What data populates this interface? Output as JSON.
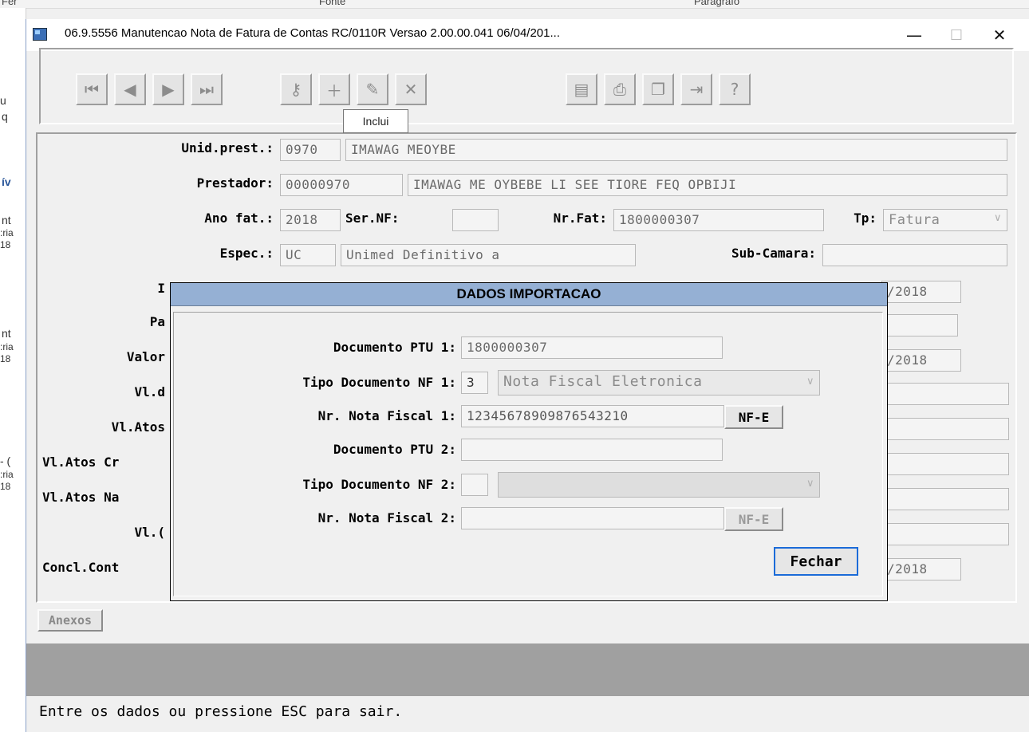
{
  "background": {
    "top_texts": [
      "Fer",
      "Fonte",
      "Parágrafo"
    ],
    "left_texts": [
      "u",
      "q",
      "ív",
      "nt",
      ":ria",
      "18",
      "nt",
      ":ria",
      "18",
      "- (",
      ":ria",
      "18"
    ]
  },
  "window": {
    "title": "06.9.5556 Manutencao  Nota de Fatura de Contas RC/0110R Versao 2.00.00.041 06/04/201...",
    "minimize": "—",
    "maximize": "☐",
    "close": "✕"
  },
  "toolbar": {
    "icons": [
      "first-record-icon",
      "prev-record-icon",
      "next-record-icon",
      "last-record-icon",
      "search-key-icon",
      "add-record-icon",
      "edit-record-icon",
      "delete-record-icon",
      "report-icon",
      "print-icon",
      "copy-icon",
      "exit-icon",
      "help-icon"
    ],
    "tooltip": "Inclui"
  },
  "form": {
    "unid_prest_label": "Unid.prest.:",
    "unid_prest_code": "0970",
    "unid_prest_name": "IMAWAG MEOYBE",
    "prestador_label": "Prestador:",
    "prestador_code": "00000970",
    "prestador_name": "IMAWAG ME OYBEBE LI SEE TIORE FEQ OPBIJI",
    "ano_fat_label": "Ano fat.:",
    "ano_fat": "2018",
    "ser_nf_label": "Ser.NF:",
    "ser_nf": "",
    "nr_fat_label": "Nr.Fat:",
    "nr_fat": "1800000307",
    "tp_label": "Tp:",
    "tp_value": "Fatura",
    "espec_label": "Espec.:",
    "espec_code": "UC",
    "espec_desc": "Unimed Definitivo a",
    "sub_camara_label": "Sub-Camara:",
    "sub_camara": "",
    "row5_label_partial": "I",
    "row6_label_partial": "Pa",
    "row7_label_partial": "Valor",
    "row8_label_partial": "Vl.d",
    "row9_label_partial": "Vl.Atos",
    "row10_label_partial": "Vl.Atos Cr",
    "row11_label_partial": "Vl.Atos Na",
    "row12_label_partial": "Vl.(",
    "row13_label_partial": "Concl.Cont",
    "date1_partial": "/2018",
    "date2_partial": "/2018",
    "date3_partial": "/2018",
    "anexos_label": "Anexos"
  },
  "dialog": {
    "title": "DADOS IMPORTACAO",
    "doc_ptu1_label": "Documento PTU 1:",
    "doc_ptu1": "1800000307",
    "tipo_doc1_label": "Tipo Documento NF 1:",
    "tipo_doc1_code": "3",
    "tipo_doc1_desc": "Nota Fiscal Eletronica",
    "nr_nf1_label": "Nr. Nota Fiscal 1:",
    "nr_nf1": "12345678909876543210",
    "nfe1_button": "NF-E",
    "doc_ptu2_label": "Documento PTU 2:",
    "doc_ptu2": "",
    "tipo_doc2_label": "Tipo Documento NF 2:",
    "tipo_doc2_code": "",
    "tipo_doc2_desc": "",
    "nr_nf2_label": "Nr. Nota Fiscal 2:",
    "nr_nf2": "",
    "nfe2_button": "NF-E",
    "close_button": "Fechar"
  },
  "status": {
    "message": "Entre os dados ou pressione ESC para sair."
  }
}
